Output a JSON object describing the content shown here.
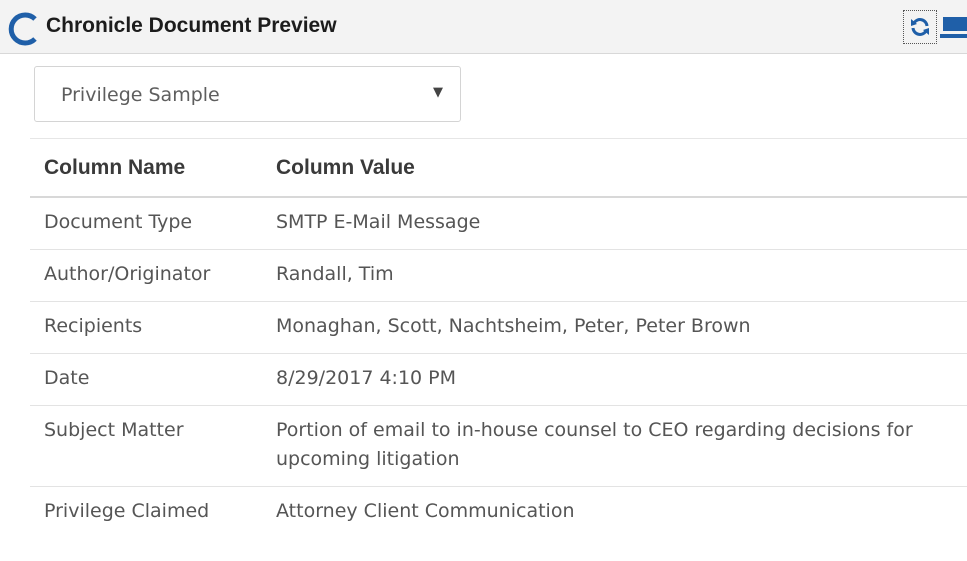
{
  "header": {
    "title": "Chronicle Document Preview",
    "brand_color": "#1f5fa8",
    "logo_icon": "chronicle-logo-c",
    "refresh_icon": "refresh-icon",
    "panel_icon": "panel-icon"
  },
  "selector": {
    "selected": "Privilege Sample",
    "arrow": "▼"
  },
  "table": {
    "headers": [
      "Column Name",
      "Column Value"
    ],
    "rows": [
      {
        "name": "Document Type",
        "value": "SMTP E-Mail Message"
      },
      {
        "name": "Author/Originator",
        "value": "Randall, Tim"
      },
      {
        "name": "Recipients",
        "value": "Monaghan, Scott, Nachtsheim, Peter, Peter Brown"
      },
      {
        "name": "Date",
        "value": "8/29/2017 4:10 PM"
      },
      {
        "name": "Subject Matter",
        "value": "Portion of email to in-house counsel to CEO regarding decisions for upcoming litigation"
      },
      {
        "name": "Privilege Claimed",
        "value": "Attorney Client Communication"
      }
    ]
  }
}
